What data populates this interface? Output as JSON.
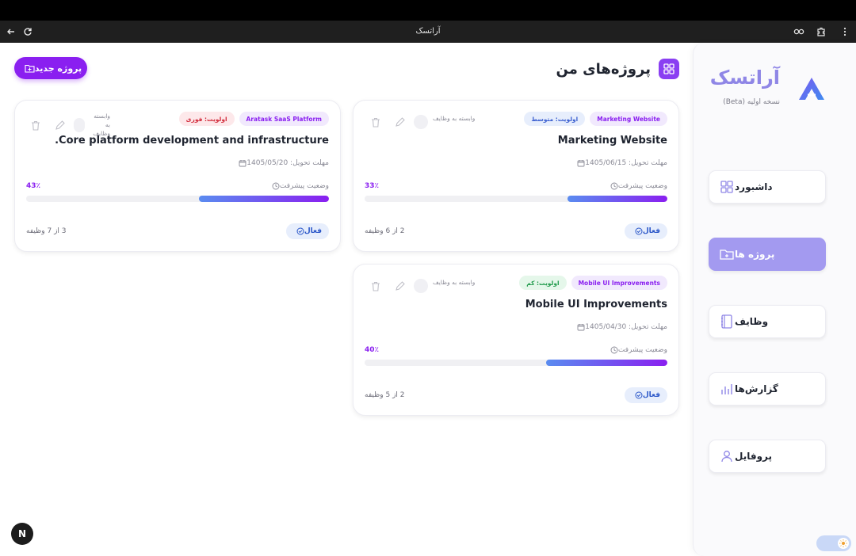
{
  "browser": {
    "tab_title": "آراتسک"
  },
  "sidebar": {
    "brand": "آراتسک",
    "version": "نسخه اولیه (Beta)",
    "items": [
      {
        "label": "داشبورد",
        "icon": "dashboard-icon"
      },
      {
        "label": "پروژه ها",
        "icon": "folder-icon"
      },
      {
        "label": "وظایف",
        "icon": "notebook-icon"
      },
      {
        "label": "گزارش‌ها",
        "icon": "bar-chart-icon"
      },
      {
        "label": "پروفایل",
        "icon": "user-icon"
      }
    ]
  },
  "header": {
    "title": "پروژه‌های من",
    "new_project_label": "پروژه جدید"
  },
  "projects": [
    {
      "project_tag": "Marketing Website",
      "priority": "اولویت: متوسط",
      "deps_label": "وابسته به وظایف",
      "title": "Marketing Website",
      "due": "مهلت تحویل: 1405/06/15",
      "progress_label": "وضعیت پیشرفت",
      "progress_pct": "33٪",
      "progress": 33,
      "status": "فعال",
      "tasks": "2 از 6 وظیفه"
    },
    {
      "project_tag": "Aratask SaaS Platform",
      "priority": "اولویت: فوری",
      "deps_label": "وابسته به وظایف",
      "title": "Core platform development and infrastructure.",
      "due": "مهلت تحویل: 1405/05/20",
      "progress_label": "وضعیت پیشرفت",
      "progress_pct": "43٪",
      "progress": 43,
      "status": "فعال",
      "tasks": "3 از 7 وظیفه"
    },
    {
      "project_tag": "Mobile UI Improvements",
      "priority": "اولویت: کم",
      "deps_label": "وابسته به وظایف",
      "title": "Mobile UI Improvements",
      "due": "مهلت تحویل: 1405/04/30",
      "progress_label": "وضعیت پیشرفت",
      "progress_pct": "40٪",
      "progress": 40,
      "status": "فعال",
      "tasks": "2 از 5 وظیفه"
    }
  ],
  "next_badge": "N",
  "colors": {
    "accent": "#8a1ff0",
    "sidebar_active": "#a39af0",
    "brand": "#8f86e6"
  }
}
